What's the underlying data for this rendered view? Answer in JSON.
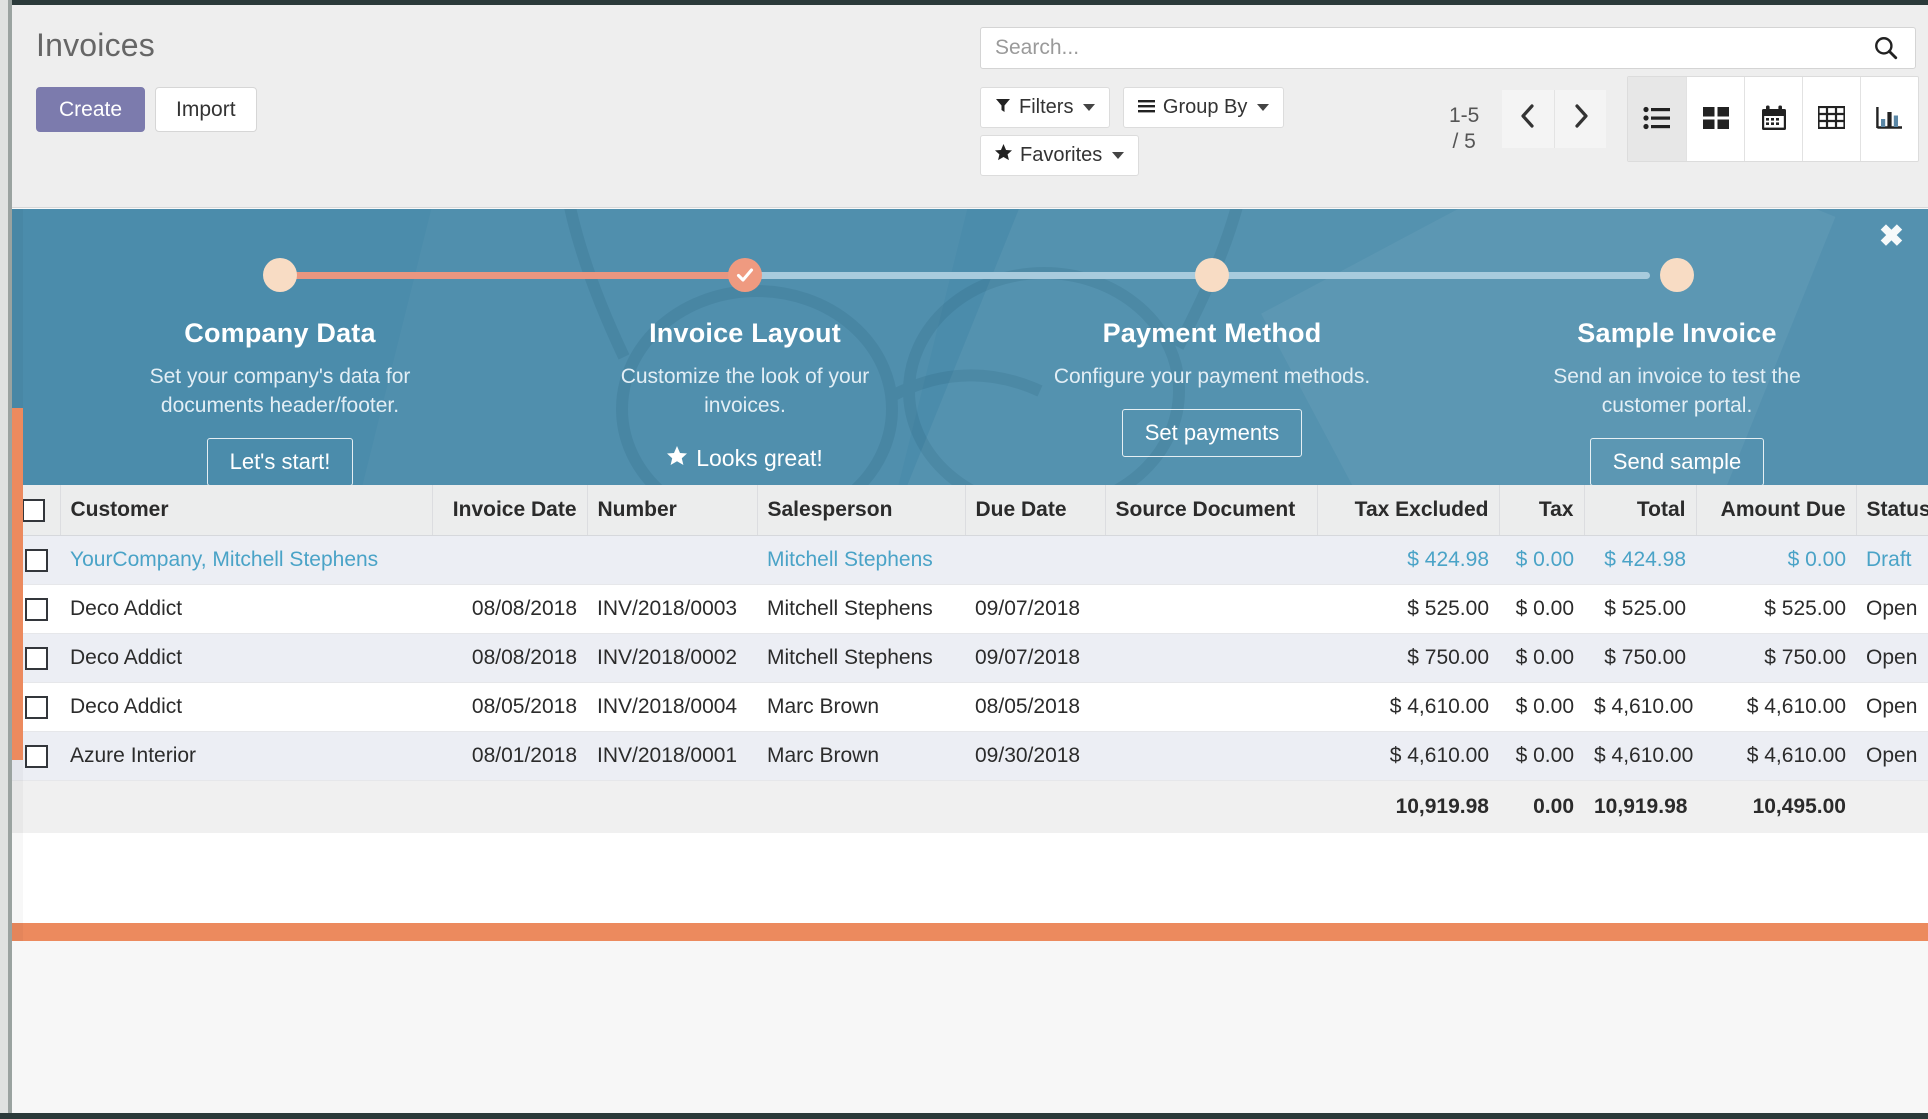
{
  "header": {
    "title": "Invoices",
    "create_label": "Create",
    "import_label": "Import"
  },
  "search": {
    "placeholder": "Search...",
    "value": "",
    "icon": "search-icon"
  },
  "filters": {
    "filters_label": "Filters",
    "group_by_label": "Group By",
    "favorites_label": "Favorites"
  },
  "pager": {
    "range": "1-5",
    "total": "/ 5",
    "prev_icon": "chevron-left-icon",
    "next_icon": "chevron-right-icon"
  },
  "view_switcher": {
    "views": [
      {
        "name": "list",
        "icon": "list-view-icon",
        "active": true
      },
      {
        "name": "kanban",
        "icon": "kanban-view-icon",
        "active": false
      },
      {
        "name": "calendar",
        "icon": "calendar-view-icon",
        "active": false
      },
      {
        "name": "pivot",
        "icon": "pivot-view-icon",
        "active": false
      },
      {
        "name": "graph",
        "icon": "graph-view-icon",
        "active": false
      }
    ]
  },
  "banner": {
    "close_label": "✖",
    "accent_done": "#ef9a80",
    "accent_todo": "#a8cbdd",
    "background": "#4b8cab",
    "steps": [
      {
        "title": "Company Data",
        "desc": "Set your company's data for documents header/footer.",
        "action": "Let's start!",
        "state": "todo"
      },
      {
        "title": "Invoice Layout",
        "desc": "Customize the look of your invoices.",
        "action": "Looks great!",
        "state": "done"
      },
      {
        "title": "Payment Method",
        "desc": "Configure your payment methods.",
        "action": "Set payments",
        "state": "todo"
      },
      {
        "title": "Sample Invoice",
        "desc": "Send an invoice to test the customer portal.",
        "action": "Send sample",
        "state": "todo"
      }
    ]
  },
  "list": {
    "columns": [
      "Customer",
      "Invoice Date",
      "Number",
      "Salesperson",
      "Due Date",
      "Source Document",
      "Tax Excluded",
      "Tax",
      "Total",
      "Amount Due",
      "Status"
    ],
    "rows": [
      {
        "customer": "YourCompany, Mitchell Stephens",
        "invoice_date": "",
        "number": "",
        "salesperson": "Mitchell Stephens",
        "due_date": "",
        "source_document": "",
        "tax_excluded": "$ 424.98",
        "tax": "$ 0.00",
        "total": "$ 424.98",
        "amount_due": "$ 0.00",
        "status": "Draft",
        "style": "draft"
      },
      {
        "customer": "Deco Addict",
        "invoice_date": "08/08/2018",
        "number": "INV/2018/0003",
        "salesperson": "Mitchell Stephens",
        "due_date": "09/07/2018",
        "source_document": "",
        "tax_excluded": "$ 525.00",
        "tax": "$ 0.00",
        "total": "$ 525.00",
        "amount_due": "$ 525.00",
        "status": "Open",
        "style": "plain"
      },
      {
        "customer": "Deco Addict",
        "invoice_date": "08/08/2018",
        "number": "INV/2018/0002",
        "salesperson": "Mitchell Stephens",
        "due_date": "09/07/2018",
        "source_document": "",
        "tax_excluded": "$ 750.00",
        "tax": "$ 0.00",
        "total": "$ 750.00",
        "amount_due": "$ 750.00",
        "status": "Open",
        "style": "alt"
      },
      {
        "customer": "Deco Addict",
        "invoice_date": "08/05/2018",
        "number": "INV/2018/0004",
        "salesperson": "Marc Brown",
        "due_date": "08/05/2018",
        "source_document": "",
        "tax_excluded": "$ 4,610.00",
        "tax": "$ 0.00",
        "total": "$ 4,610.00",
        "amount_due": "$ 4,610.00",
        "status": "Open",
        "style": "plain"
      },
      {
        "customer": "Azure Interior",
        "invoice_date": "08/01/2018",
        "number": "INV/2018/0001",
        "salesperson": "Marc Brown",
        "due_date": "09/30/2018",
        "source_document": "",
        "tax_excluded": "$ 4,610.00",
        "tax": "$ 0.00",
        "total": "$ 4,610.00",
        "amount_due": "$ 4,610.00",
        "status": "Open",
        "style": "alt"
      }
    ],
    "totals": {
      "tax_excluded": "10,919.98",
      "tax": "0.00",
      "total": "10,919.98",
      "amount_due": "10,495.00"
    }
  }
}
